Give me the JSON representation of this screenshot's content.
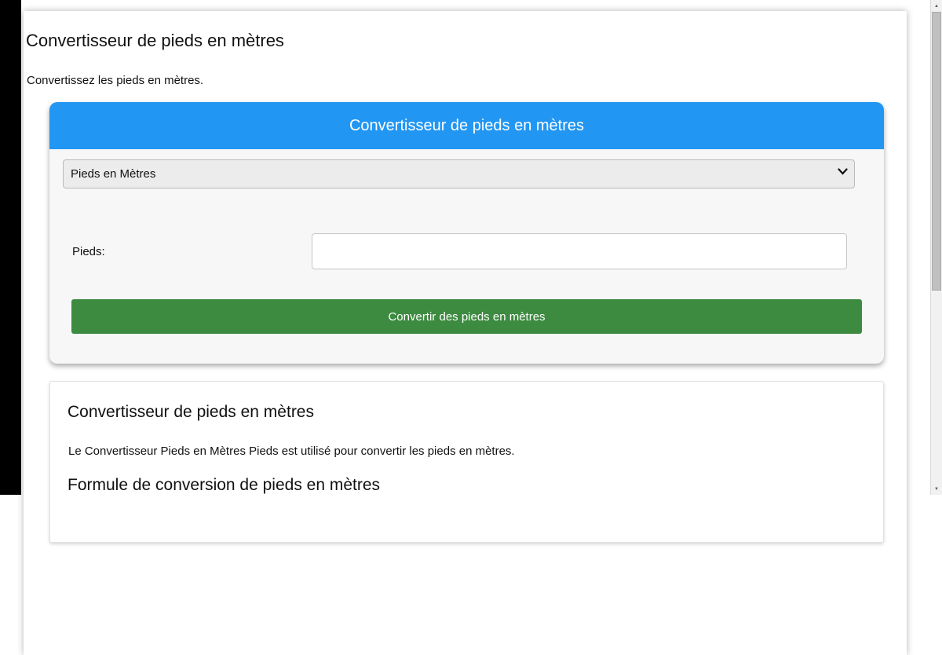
{
  "page": {
    "title": "Convertisseur de pieds en mètres",
    "intro": "Convertissez les pieds en mètres."
  },
  "converter_card": {
    "header_title": "Convertisseur de pieds en mètres",
    "unit_select_value": "Pieds en Mètres",
    "input_label": "Pieds:",
    "input_value": "",
    "convert_button_label": "Convertir des pieds en mètres"
  },
  "info_card": {
    "heading": "Convertisseur de pieds en mètres",
    "description": "Le Convertisseur Pieds en Mètres Pieds est utilisé pour convertir les pieds en mètres.",
    "formula_heading": "Formule de conversion de pieds en mètres"
  },
  "icons": {
    "scroll_up": "▲",
    "scroll_down": "▼"
  },
  "colors": {
    "header_blue": "#2196f3",
    "button_green": "#3d8b40",
    "converter_card_bg": "#f7f7f7",
    "left_strip_black": "#000000",
    "scrollbar_thumb_gray": "#c0c0c0"
  }
}
